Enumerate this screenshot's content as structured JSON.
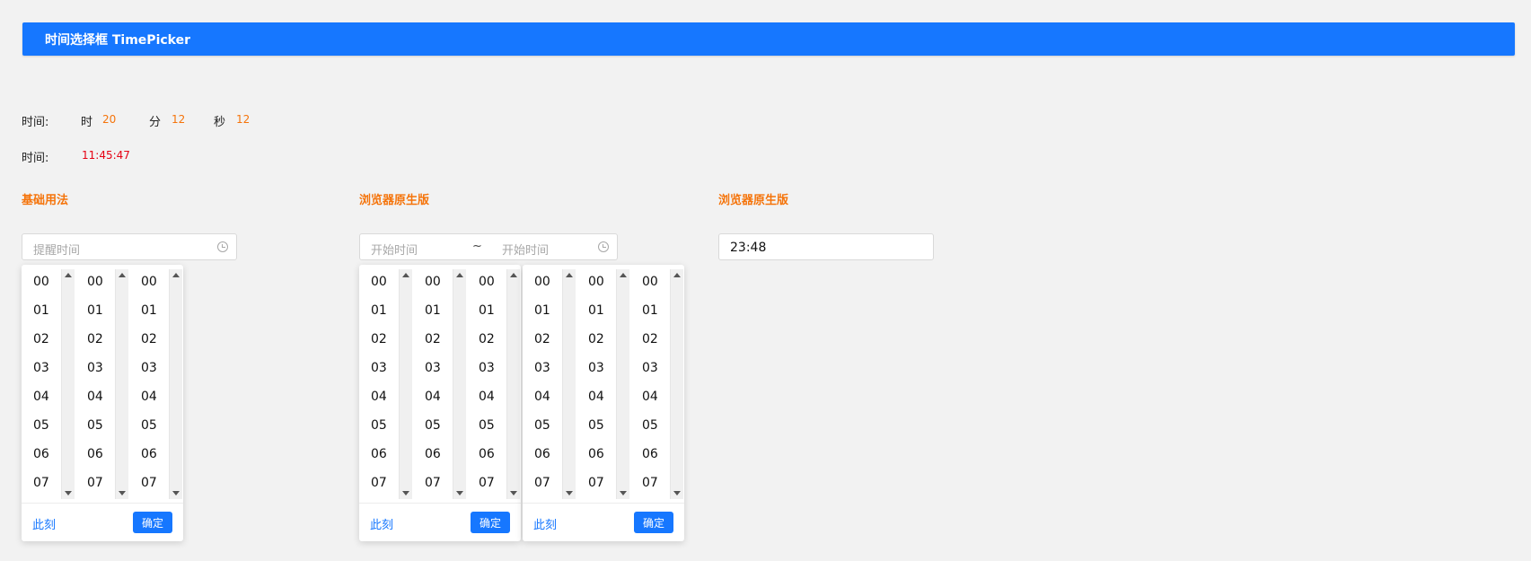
{
  "header": {
    "title": "时间选择框 TimePicker"
  },
  "summary": {
    "row1_label": "时间:",
    "hour_label": "时",
    "hour_value": "20",
    "minute_label": "分",
    "minute_value": "12",
    "second_label": "秒",
    "second_value": "12",
    "row2_label": "时间:",
    "time_value": "11:45:47"
  },
  "sections": {
    "basic": {
      "title": "基础用法",
      "placeholder": "提醒时间"
    },
    "range": {
      "title": "浏览器原生版",
      "start_placeholder": "开始时间",
      "separator": "~",
      "end_placeholder": "开始时间"
    },
    "native": {
      "title": "浏览器原生版",
      "value": "23:48"
    }
  },
  "picker": {
    "options": [
      "00",
      "01",
      "02",
      "03",
      "04",
      "05",
      "06",
      "07"
    ],
    "now_label": "此刻",
    "ok_label": "确定"
  },
  "colors": {
    "primary": "#1677ff",
    "accent": "#f5740b",
    "danger": "#e60012"
  }
}
